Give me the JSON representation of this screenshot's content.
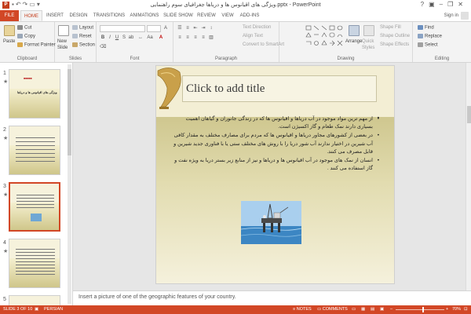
{
  "window": {
    "app_icon_letter": "P",
    "title": "ویژگی های اقیانوس ها و دریاها جغرافیای سوم راهنمایی.pptx - PowerPoint",
    "help": "?",
    "minimize": "–",
    "restore": "❐",
    "close": "✕"
  },
  "tabs": [
    "FILE",
    "HOME",
    "INSERT",
    "DESIGN",
    "TRANSITIONS",
    "ANIMATIONS",
    "SLIDE SHOW",
    "REVIEW",
    "VIEW",
    "ADD-INS"
  ],
  "active_tab": "HOME",
  "sign_in": "Sign in",
  "ribbon": {
    "clipboard": {
      "label": "Clipboard",
      "paste": "Paste",
      "cut": "Cut",
      "copy": "Copy",
      "format_painter": "Format Painter"
    },
    "slides": {
      "label": "Slides",
      "new_slide": "New",
      "new_slide_2": "Slide",
      "layout": "Layout",
      "reset": "Reset",
      "section": "Section"
    },
    "font": {
      "label": "Font"
    },
    "paragraph": {
      "label": "Paragraph",
      "text_direction": "Text Direction",
      "align_text": "Align Text",
      "convert_smartart": "Convert to SmartArt"
    },
    "drawing": {
      "label": "Drawing",
      "arrange": "Arrange",
      "quick_styles": "Quick",
      "quick_styles_2": "Styles",
      "shape_fill": "Shape Fill",
      "shape_outline": "Shape Outline",
      "shape_effects": "Shape Effects"
    },
    "editing": {
      "label": "Editing",
      "find": "Find",
      "replace": "Replace",
      "select": "Select"
    }
  },
  "slide_pane": {
    "thumbnails": [
      {
        "number": "1",
        "text": "ویژگی های اقیانوس ها و دریاها"
      },
      {
        "number": "2"
      },
      {
        "number": "3"
      },
      {
        "number": "4"
      },
      {
        "number": "5"
      }
    ],
    "star": "★",
    "selected": 3
  },
  "slide": {
    "title_placeholder": "Click to add title",
    "bullets": [
      "",
      "از مهم ترین مواد موجود در آب دریاها و اقیانوس ها که در زندگی جانوران و گیاهان اهمیت بسیاری دارند نمک طعام و گاز اکسیژن است.",
      "در بعضی از کشورهای مجاور دریاها و اقیانوس ها که مردم برای مصارف مختلف به مقدار کافی آب شیرین در اختیار ندارند آب شور دریا را با روش های مختلف ستی یا با فناوری جدید شیرین و قابل مصرف می کنند.",
      "انسان از نمک های موجود در آب اقیانوس ها و دریاها و نیز از منابع زیر بستر دریا به ویژه نفت و گاز استفاده می کنند ."
    ]
  },
  "notes": {
    "text": "Insert a picture of one of the geographic features of your country."
  },
  "status": {
    "slide_indicator": "SLIDE 3 OF 10",
    "language": "PERSIAN",
    "notes_btn": "NOTES",
    "comments_btn": "COMMENTS",
    "zoom_minus": "–",
    "zoom_plus": "+",
    "zoom": "70%"
  },
  "colors": {
    "accent": "#d24726",
    "ribbon_bg": "#f3f3f3",
    "workspace": "#e6e6e6"
  }
}
